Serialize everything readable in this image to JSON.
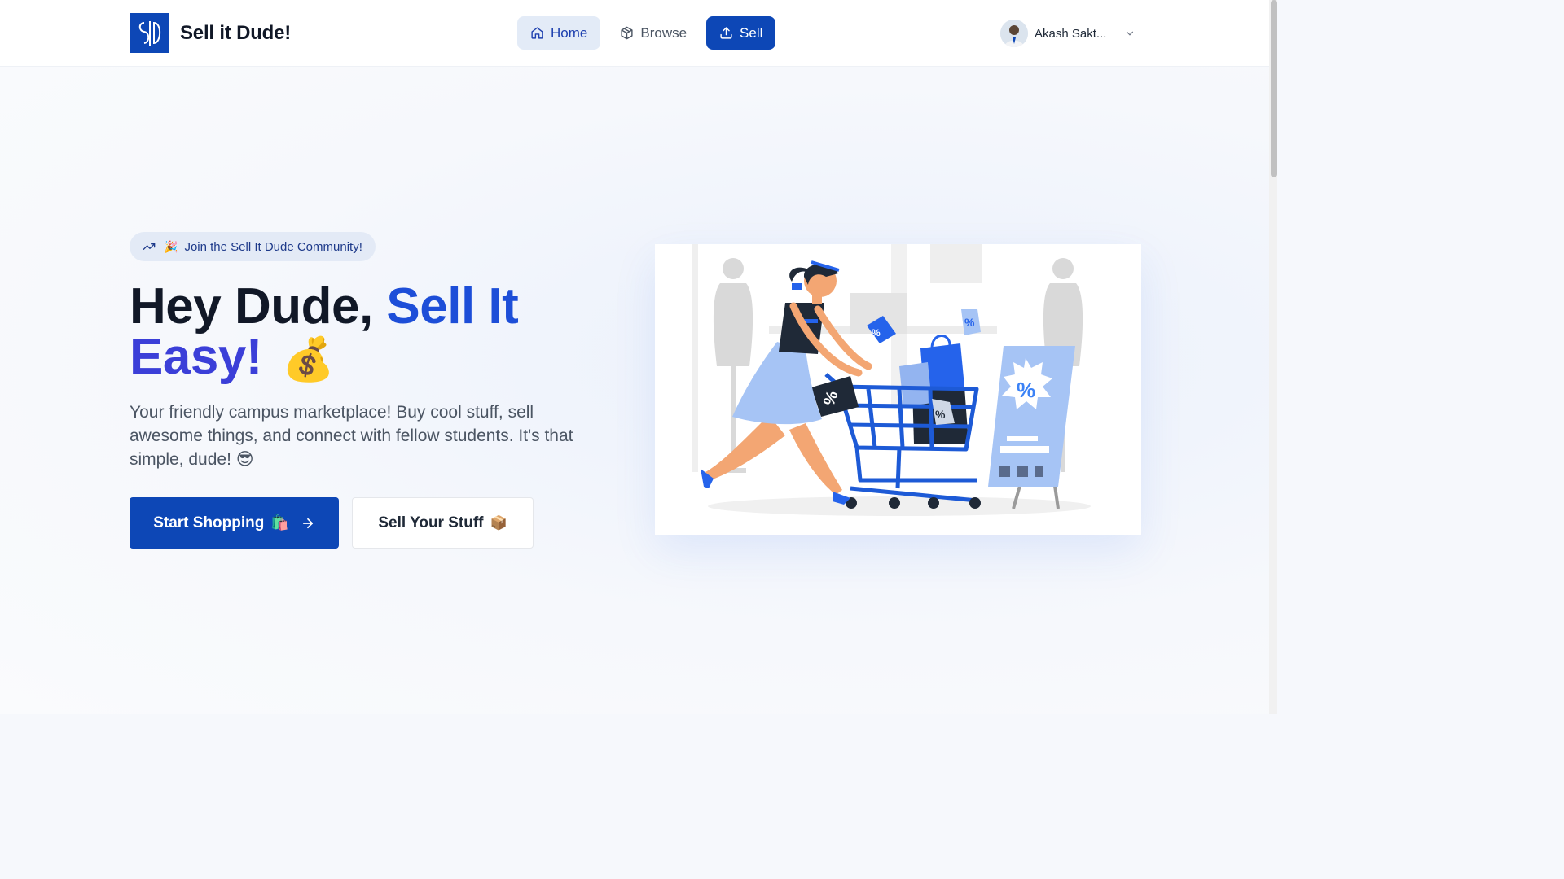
{
  "brand": {
    "name": "Sell it Dude!",
    "logo_icon": "sid-monogram-icon"
  },
  "nav": {
    "links": [
      {
        "label": "Home",
        "icon": "home-icon",
        "state": "active"
      },
      {
        "label": "Browse",
        "icon": "package-icon",
        "state": "default"
      },
      {
        "label": "Sell",
        "icon": "upload-icon",
        "state": "primary"
      }
    ]
  },
  "user": {
    "name": "Akash Sakt...",
    "avatar_icon": "user-avatar",
    "menu_icon": "chevron-down-icon"
  },
  "hero": {
    "badge": {
      "icon": "trending-up-icon",
      "emoji": "🎉",
      "text": "Join the Sell It Dude Community!"
    },
    "headline": {
      "part1": "Hey Dude, ",
      "part2": "Sell It",
      "part3": "Easy!",
      "emoji": "💰"
    },
    "subtext": "Your friendly campus marketplace! Buy cool stuff, sell awesome things, and connect with fellow students. It's that simple, dude! 😎",
    "primary_button": {
      "label": "Start Shopping",
      "emoji": "🛍️",
      "icon": "arrow-right-icon"
    },
    "secondary_button": {
      "label": "Sell Your Stuff",
      "emoji": "📦"
    },
    "illustration": "shopping-cart-woman-illustration"
  },
  "colors": {
    "primary": "#0d47b6",
    "accent_blue": "#1d4ed8",
    "accent_indigo": "#3b3fd8",
    "nav_active_bg": "#e3ebf7",
    "badge_bg": "#e3eaf6"
  }
}
